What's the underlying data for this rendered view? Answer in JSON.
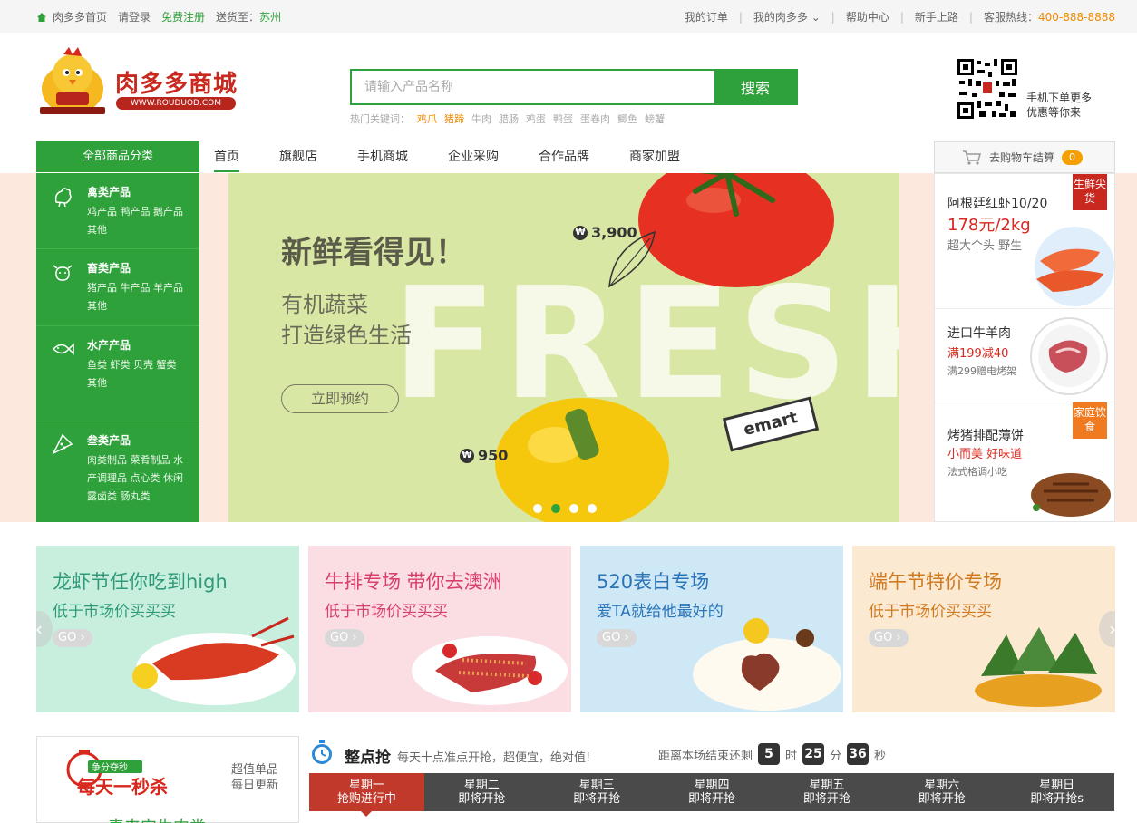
{
  "topbar": {
    "home": "肉多多首页",
    "login": "请登录",
    "register": "免费注册",
    "ship_to_label": "送货至：",
    "ship_to_city": "苏州",
    "my_orders": "我的订单",
    "my_account": "我的肉多多",
    "help": "帮助中心",
    "newbie": "新手上路",
    "hotline_label": "客服热线：",
    "hotline": "400-888-8888"
  },
  "logo": {
    "name": "肉多多商城",
    "url": "WWW.ROUDUOD.COM"
  },
  "search": {
    "placeholder": "请输入产品名称",
    "button": "搜索",
    "hot_label": "热门关键词：",
    "hot_words": [
      "鸡爪",
      "猪蹄",
      "牛肉",
      "腊肠",
      "鸡蛋",
      "鸭蛋",
      "蛋卷肉",
      "鲫鱼",
      "螃蟹"
    ]
  },
  "qr": {
    "line1": "手机下单更多",
    "line2": "优惠等你来"
  },
  "nav": {
    "all_categories": "全部商品分类",
    "items": [
      "首页",
      "旗舰店",
      "手机商城",
      "企业采购",
      "合作品牌",
      "商家加盟"
    ],
    "cart_label": "去购物车结算",
    "cart_count": "0"
  },
  "categories": [
    {
      "title": "禽类产品",
      "subs": "鸡产品 鸭产品 鹅产品 其他"
    },
    {
      "title": "畜类产品",
      "subs": "猪产品 牛产品 羊产品 其他"
    },
    {
      "title": "水产产品",
      "subs": "鱼类 虾类 贝壳 蟹类 其他"
    },
    {
      "title": "叁类产品",
      "subs": "肉类制品 菜肴制品 水产调理品 点心类 休闲露卤类 肠丸类"
    }
  ],
  "banner": {
    "headline": "新鲜看得见！",
    "line1": "有机蔬菜",
    "line2": "打造绿色生活",
    "button": "立即预约",
    "price1": "3,900",
    "price2": "950",
    "fresh": "FRESH",
    "brand": "emart",
    "active_slide": 2
  },
  "promos": [
    {
      "title": "阿根廷红虾10/20",
      "price": "178元/2kg",
      "desc": "超大个头 野生",
      "tag": "生鲜尖货",
      "tag_color": "#c8281e"
    },
    {
      "title": "进口牛羊肉",
      "price": "满199减40",
      "desc": "满299赠电烤架",
      "tag": "",
      "tag_color": ""
    },
    {
      "title": "烤猪排配薄饼",
      "price": "小而美 好味道",
      "desc": "法式格调小吃",
      "tag": "家庭饮食",
      "tag_color": "#f07a20"
    }
  ],
  "topics": [
    {
      "title": "龙虾节任你吃到high",
      "sub": "低于市场价买买买",
      "go": "GO",
      "bg": "#c8efde",
      "title_color": "#2e9a7a",
      "sub_color": "#2e9a7a"
    },
    {
      "title": "牛排专场 带你去澳洲",
      "sub": "低于市场价买买买",
      "go": "GO",
      "bg": "#fbdde4",
      "title_color": "#d8406a",
      "sub_color": "#d8406a"
    },
    {
      "title": "520表白专场",
      "sub": "爱TA就给他最好的",
      "go": "GO",
      "bg": "#cfe8f6",
      "title_color": "#2a74b8",
      "sub_color": "#2a74b8"
    },
    {
      "title": "端午节特价专场",
      "sub": "低于市场价买买买",
      "go": "GO",
      "bg": "#fbe9d2",
      "title_color": "#d07a20",
      "sub_color": "#d07a20"
    }
  ],
  "flash": {
    "badge_top": "争分夺秒",
    "badge_main": "每天一秒杀",
    "side1": "超值单品",
    "side2": "每日更新",
    "bottom": "素来安生肉类",
    "title": "整点抢",
    "subtitle": "每天十点准点开抢，超便宜，绝对值!",
    "countdown_label": "距离本场结束还剩",
    "hours": "5",
    "hours_unit": "时",
    "minutes": "25",
    "minutes_unit": "分",
    "seconds": "36",
    "seconds_unit": "秒",
    "days": [
      {
        "day": "星期一",
        "status": "抢购进行中"
      },
      {
        "day": "星期二",
        "status": "即将开抢"
      },
      {
        "day": "星期三",
        "status": "即将开抢"
      },
      {
        "day": "星期四",
        "status": "即将开抢"
      },
      {
        "day": "星期五",
        "status": "即将开抢"
      },
      {
        "day": "星期六",
        "status": "即将开抢"
      },
      {
        "day": "星期日",
        "status": "即将开抢s"
      }
    ]
  }
}
